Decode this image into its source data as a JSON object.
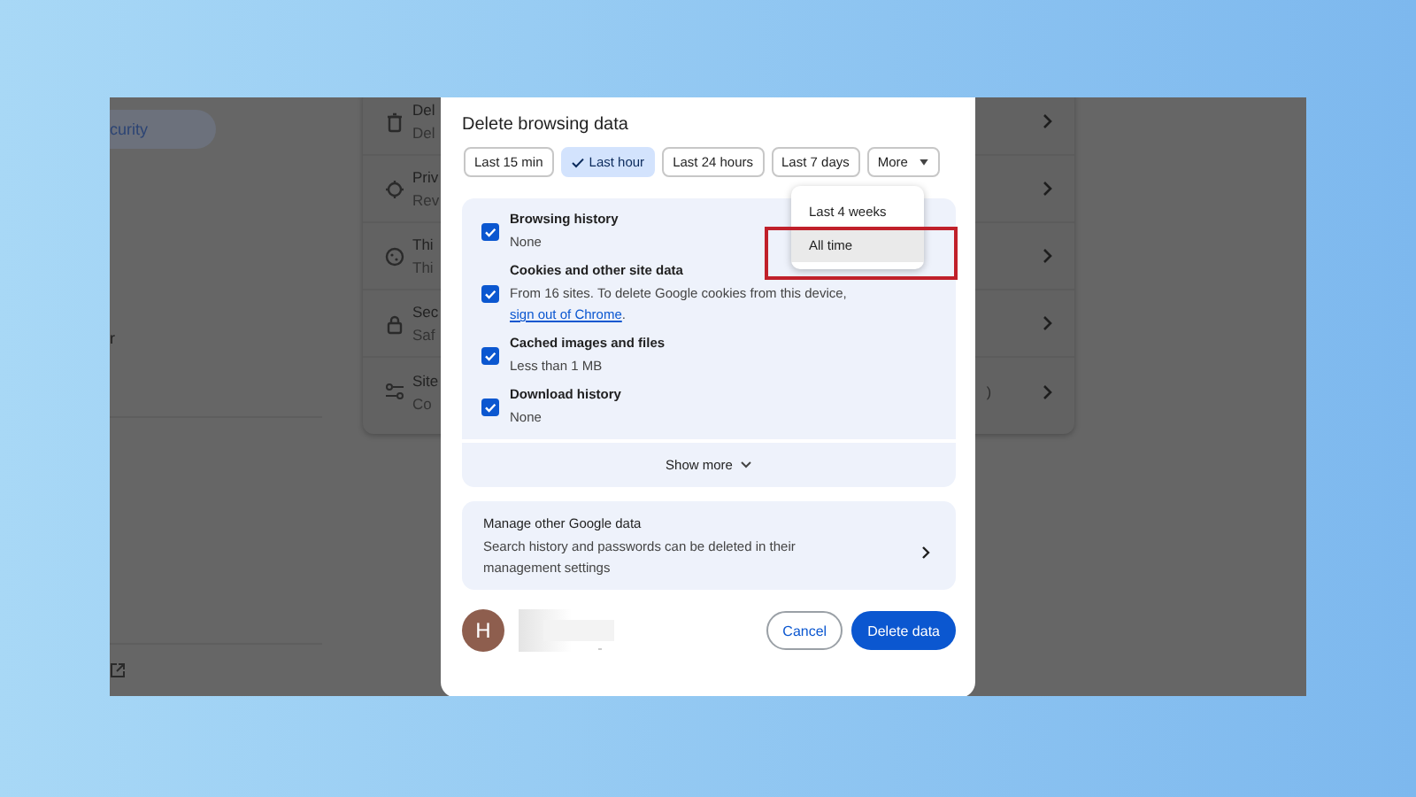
{
  "background": {
    "sidebar": [
      {
        "label": "curity",
        "selected": true
      },
      {
        "label": "r",
        "selected": false
      }
    ],
    "card_rows": [
      {
        "title": "Del",
        "subtitle": "Del"
      },
      {
        "title": "Priv",
        "subtitle": "Rev"
      },
      {
        "title": "Thi",
        "subtitle": "Thi"
      },
      {
        "title": "Sec",
        "subtitle": "Saf"
      },
      {
        "title": "Site",
        "subtitle": "Co",
        "trailing": ")"
      }
    ]
  },
  "dialog": {
    "title": "Delete browsing data",
    "time_ranges": [
      {
        "label": "Last 15 min",
        "selected": false,
        "kind": "range"
      },
      {
        "label": "Last hour",
        "selected": true,
        "kind": "range"
      },
      {
        "label": "Last 24 hours",
        "selected": false,
        "kind": "range"
      },
      {
        "label": "Last 7 days",
        "selected": false,
        "kind": "range"
      },
      {
        "label": "More",
        "selected": false,
        "kind": "dropdown"
      }
    ],
    "range_menu": [
      {
        "label": "Last 4 weeks",
        "hovered": false,
        "highlighted": false
      },
      {
        "label": "All time",
        "hovered": true,
        "highlighted": true
      }
    ],
    "items": [
      {
        "title": "Browsing history",
        "detail": "None",
        "checked": true
      },
      {
        "title": "Cookies and other site data",
        "detail": "From 16 sites. To delete Google cookies from this device, ",
        "link": "sign out of Chrome",
        "detail_end": ".",
        "checked": true
      },
      {
        "title": "Cached images and files",
        "detail": "Less than 1 MB",
        "checked": true
      },
      {
        "title": "Download history",
        "detail": "None",
        "checked": true
      }
    ],
    "show_more": "Show more",
    "manage": {
      "title": "Manage other Google data",
      "text": "Search history and passwords can be deleted in their management settings"
    },
    "account": {
      "initial": "H"
    },
    "buttons": [
      {
        "label": "Cancel",
        "kind": "secondary"
      },
      {
        "label": "Delete data",
        "kind": "primary"
      }
    ]
  }
}
